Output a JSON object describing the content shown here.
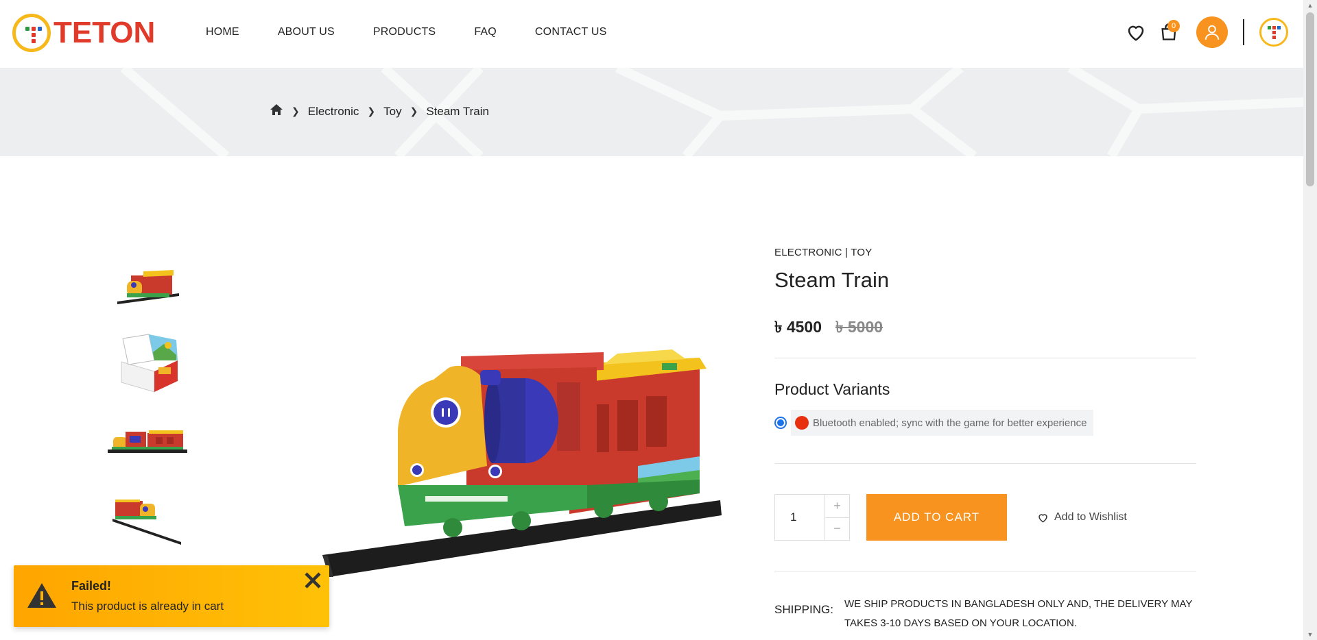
{
  "header": {
    "logo_text": "TETON",
    "nav": [
      {
        "label": "HOME"
      },
      {
        "label": "ABOUT US"
      },
      {
        "label": "PRODUCTS"
      },
      {
        "label": "FAQ"
      },
      {
        "label": "CONTACT US"
      }
    ],
    "cart_count": "0",
    "icons": [
      "heart-icon",
      "bag-icon",
      "user-icon",
      "teton-badge-icon"
    ]
  },
  "breadcrumb": {
    "home_icon": "home-icon",
    "items": [
      "Electronic",
      "Toy",
      "Steam Train"
    ]
  },
  "product": {
    "categories": "ELECTRONIC | TOY",
    "title": "Steam Train",
    "price_now": "৳ 4500",
    "price_old": "৳ 5000",
    "variants_title": "Product Variants",
    "variant_label": "Bluetooth enabled; sync with the game for better experience",
    "variant_color": "#e8300f",
    "quantity": "1",
    "add_to_cart": "ADD TO CART",
    "add_to_wishlist": "Add to Wishlist",
    "shipping_label": "SHIPPING:",
    "shipping_text": "We ship products in Bangladesh only and, the delivery may takes 3-10 days based on your location."
  },
  "toast": {
    "title": "Failed!",
    "message": "This product is already in cart"
  },
  "colors": {
    "accent": "#f7931e",
    "logo_red": "#e03a2a",
    "logo_yellow": "#f6b81a",
    "radio_blue": "#1a73e8"
  }
}
